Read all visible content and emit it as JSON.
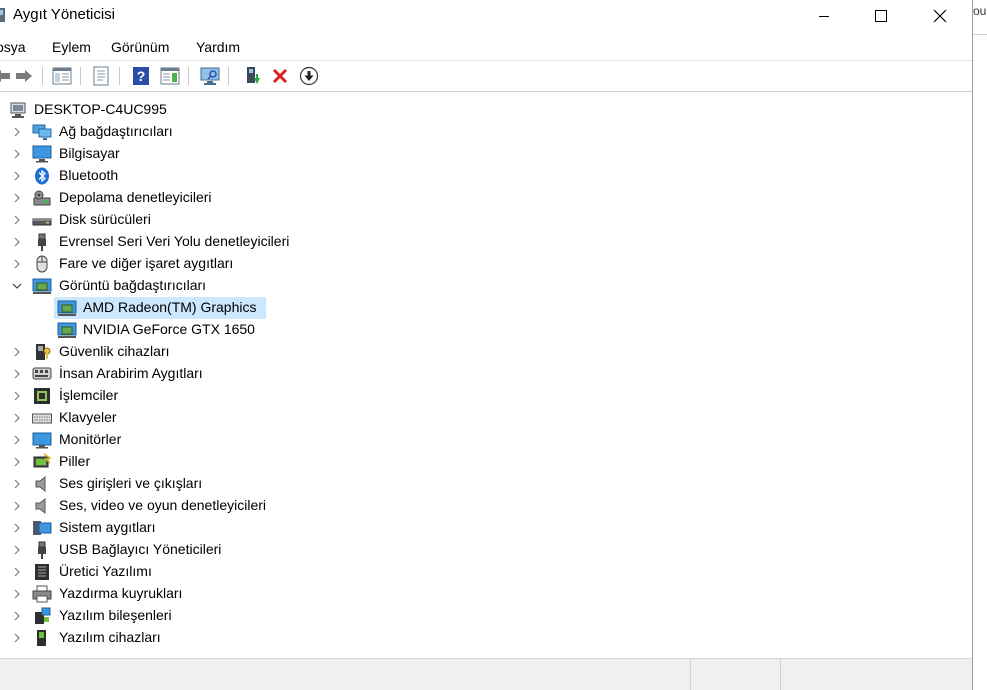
{
  "window": {
    "title": "Aygıt Yöneticisi"
  },
  "background": {
    "fragment_text": "ou"
  },
  "menu": {
    "items": [
      "osya",
      "Eylem",
      "Görünüm",
      "Yardım"
    ]
  },
  "toolbar": {
    "buttons": [
      "back-arrow-icon",
      "forward-arrow-icon",
      "show-hide-console-tree-icon",
      "properties-icon",
      "help-icon",
      "action-pane-icon",
      "scan-hardware-icon",
      "update-driver-icon",
      "uninstall-device-icon",
      "disable-device-icon"
    ]
  },
  "tree": {
    "root": "DESKTOP-C4UC995",
    "categories": [
      {
        "label": "Ağ bağdaştırıcıları",
        "icon": "network-adapter-icon"
      },
      {
        "label": "Bilgisayar",
        "icon": "computer-icon"
      },
      {
        "label": "Bluetooth",
        "icon": "bluetooth-icon"
      },
      {
        "label": "Depolama denetleyicileri",
        "icon": "storage-controller-icon"
      },
      {
        "label": "Disk sürücüleri",
        "icon": "disk-drive-icon"
      },
      {
        "label": "Evrensel Seri Veri Yolu denetleyicileri",
        "icon": "usb-controller-icon"
      },
      {
        "label": "Fare ve diğer işaret aygıtları",
        "icon": "mouse-icon"
      },
      {
        "label": "Görüntü bağdaştırıcıları",
        "icon": "display-adapter-icon",
        "expanded": true,
        "children": [
          {
            "label": "AMD Radeon(TM) Graphics",
            "icon": "display-adapter-icon",
            "selected": true
          },
          {
            "label": "NVIDIA GeForce GTX 1650",
            "icon": "display-adapter-icon"
          }
        ]
      },
      {
        "label": "Güvenlik cihazları",
        "icon": "security-device-icon"
      },
      {
        "label": "İnsan Arabirim Aygıtları",
        "icon": "hid-icon"
      },
      {
        "label": "İşlemciler",
        "icon": "processor-icon"
      },
      {
        "label": "Klavyeler",
        "icon": "keyboard-icon"
      },
      {
        "label": "Monitörler",
        "icon": "monitor-icon"
      },
      {
        "label": "Piller",
        "icon": "battery-icon"
      },
      {
        "label": "Ses girişleri ve çıkışları",
        "icon": "audio-io-icon"
      },
      {
        "label": "Ses, video ve oyun denetleyicileri",
        "icon": "sound-controller-icon"
      },
      {
        "label": "Sistem aygıtları",
        "icon": "system-device-icon"
      },
      {
        "label": "USB Bağlayıcı Yöneticileri",
        "icon": "usb-connector-icon"
      },
      {
        "label": "Üretici Yazılımı",
        "icon": "firmware-icon"
      },
      {
        "label": "Yazdırma kuyrukları",
        "icon": "print-queue-icon"
      },
      {
        "label": "Yazılım bileşenleri",
        "icon": "software-component-icon"
      },
      {
        "label": "Yazılım cihazları",
        "icon": "software-device-icon"
      }
    ]
  },
  "colors": {
    "selection": "#cce8ff",
    "accent_blue": "#2b79d0",
    "uninstall_red": "#e02020"
  }
}
